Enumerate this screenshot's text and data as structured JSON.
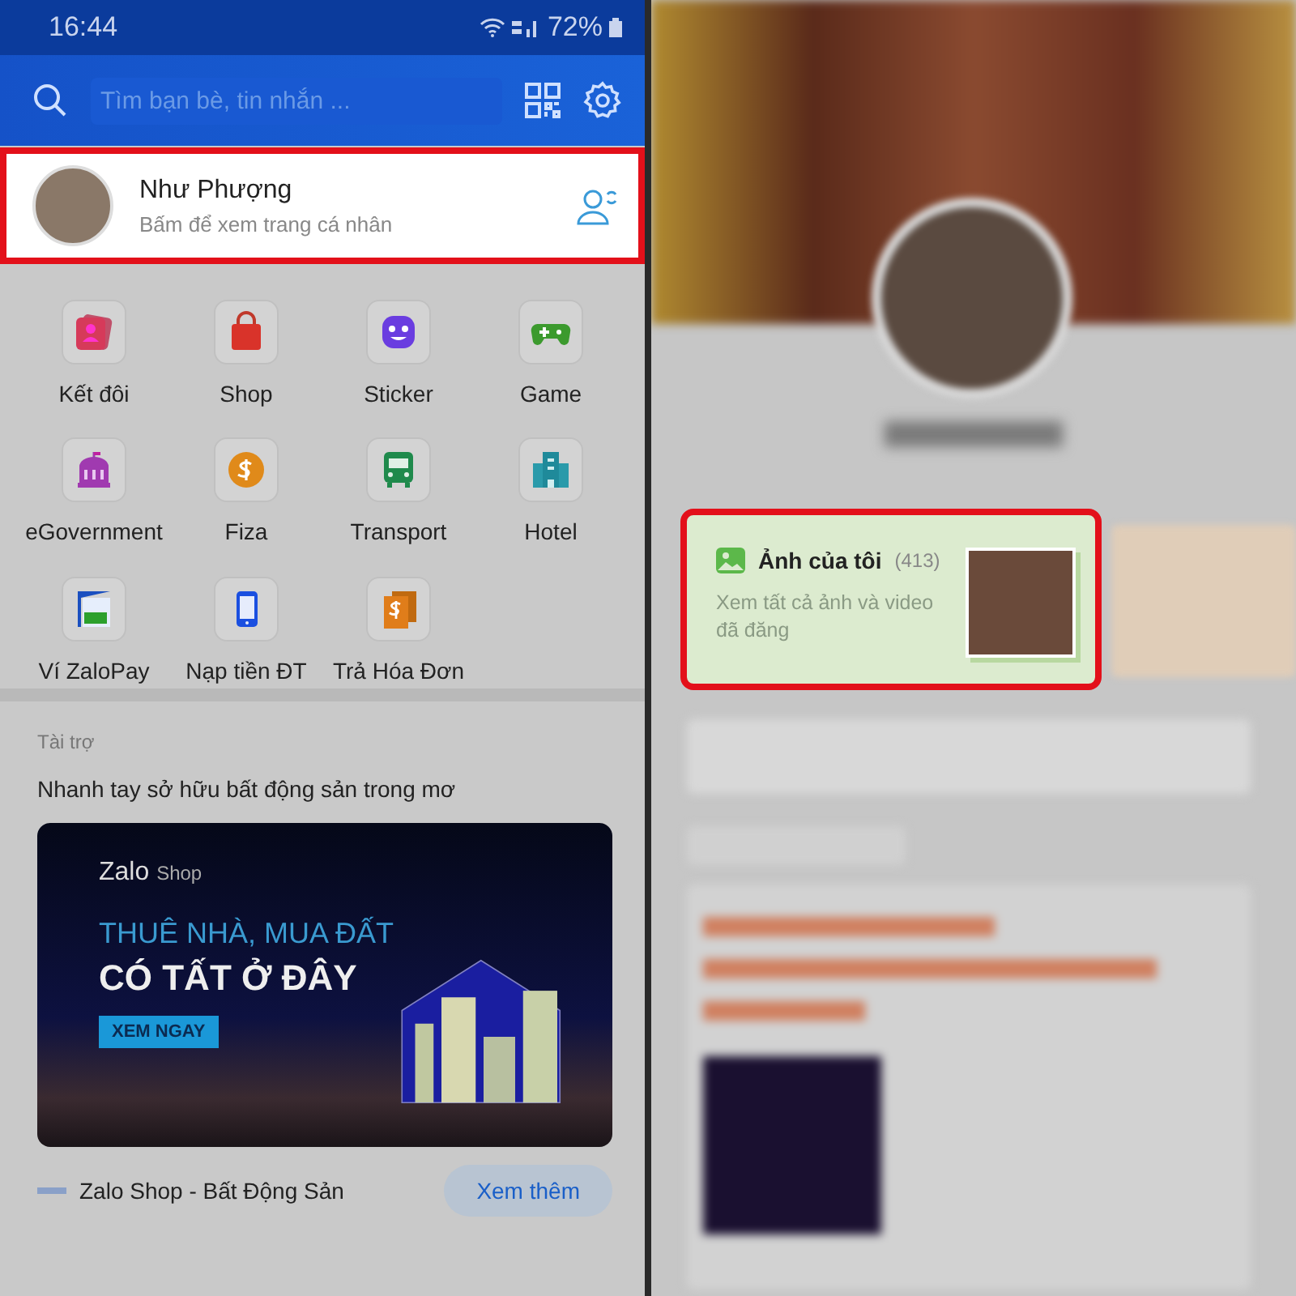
{
  "left_screen": {
    "status_bar": {
      "time": "16:44",
      "battery": "72%"
    },
    "search": {
      "placeholder": "Tìm bạn bè, tin nhắn ..."
    },
    "profile": {
      "name": "Như Phượng",
      "subtitle": "Bấm để xem trang cá nhân",
      "highlighted": true
    },
    "apps": [
      {
        "label": "Kết đôi",
        "kind": "cards"
      },
      {
        "label": "Shop",
        "kind": "bag"
      },
      {
        "label": "Sticker",
        "kind": "smiley"
      },
      {
        "label": "Game",
        "kind": "gamepad"
      },
      {
        "label": "eGovernment",
        "kind": "building"
      },
      {
        "label": "Fiza",
        "kind": "coin"
      },
      {
        "label": "Transport",
        "kind": "bus"
      },
      {
        "label": "Hotel",
        "kind": "hotel"
      },
      {
        "label": "Ví ZaloPay",
        "kind": "wallet"
      },
      {
        "label": "Nạp tiền ĐT",
        "kind": "phone"
      },
      {
        "label": "Trả Hóa Đơn",
        "kind": "bill"
      }
    ],
    "sponsored": {
      "label": "Tài trợ",
      "headline": "Nhanh tay sở hữu bất động sản trong mơ",
      "banner": {
        "brand": "Zalo",
        "brand_suffix": "Shop",
        "line_1": "THUÊ NHÀ, MUA ĐẤT",
        "line_2": "CÓ TẤT Ở ĐÂY",
        "cta": "XEM NGAY"
      },
      "advertiser": "Zalo Shop - Bất Động Sản",
      "button": "Xem thêm"
    }
  },
  "right_screen": {
    "photos_card": {
      "title": "Ảnh của tôi",
      "count": "(413)",
      "description": "Xem tất cả ảnh và video đã đăng",
      "highlighted": true
    }
  }
}
